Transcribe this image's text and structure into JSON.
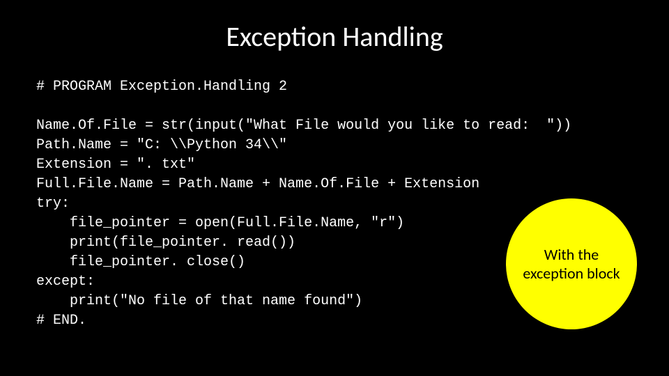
{
  "title": "Exception Handling",
  "code": {
    "line1": "# PROGRAM Exception.Handling 2",
    "line2": "",
    "line3": "Name.Of.File = str(input(\"What File would you like to read:  \"))",
    "line4": "Path.Name = \"C: \\\\Python 34\\\\\"",
    "line5": "Extension = \". txt\"",
    "line6": "Full.File.Name = Path.Name + Name.Of.File + Extension",
    "line7": "try:",
    "line8": "    file_pointer = open(Full.File.Name, \"r\")",
    "line9": "    print(file_pointer. read())",
    "line10": "    file_pointer. close()",
    "line11": "except:",
    "line12": "    print(\"No file of that name found\")",
    "line13": "# END."
  },
  "callout": {
    "text": "With the exception block"
  },
  "colors": {
    "background": "#000000",
    "text": "#ffffff",
    "callout_bg": "#ffff00",
    "callout_text": "#000000"
  }
}
